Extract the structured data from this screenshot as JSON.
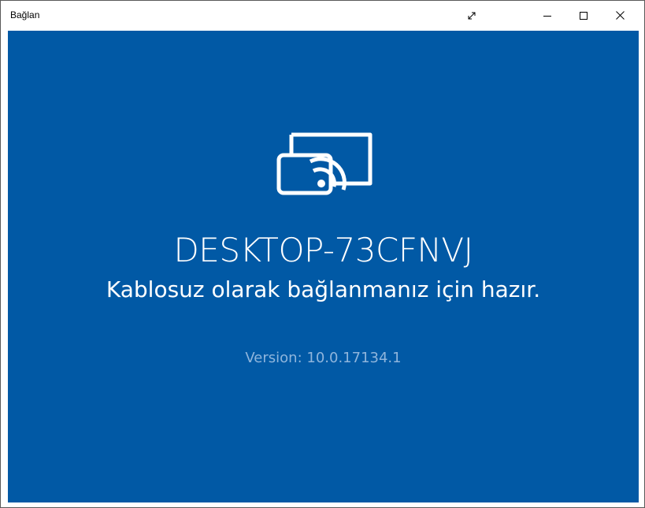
{
  "window": {
    "title": "Bağlan"
  },
  "titlebar_buttons": {
    "fullscreen_icon": "expand-diagonal-icon",
    "minimize_icon": "minimize-icon",
    "maximize_icon": "maximize-icon",
    "close_icon": "close-icon"
  },
  "main": {
    "icon": "wireless-display-icon",
    "device_name": "DESKTOP-73CFNVJ",
    "status": "Kablosuz olarak bağlanmanız için hazır.",
    "version": "Version: 10.0.17134.1"
  },
  "colors": {
    "background": "#0159a5",
    "text": "#ffffff",
    "version_text": "#8fb5dc"
  }
}
